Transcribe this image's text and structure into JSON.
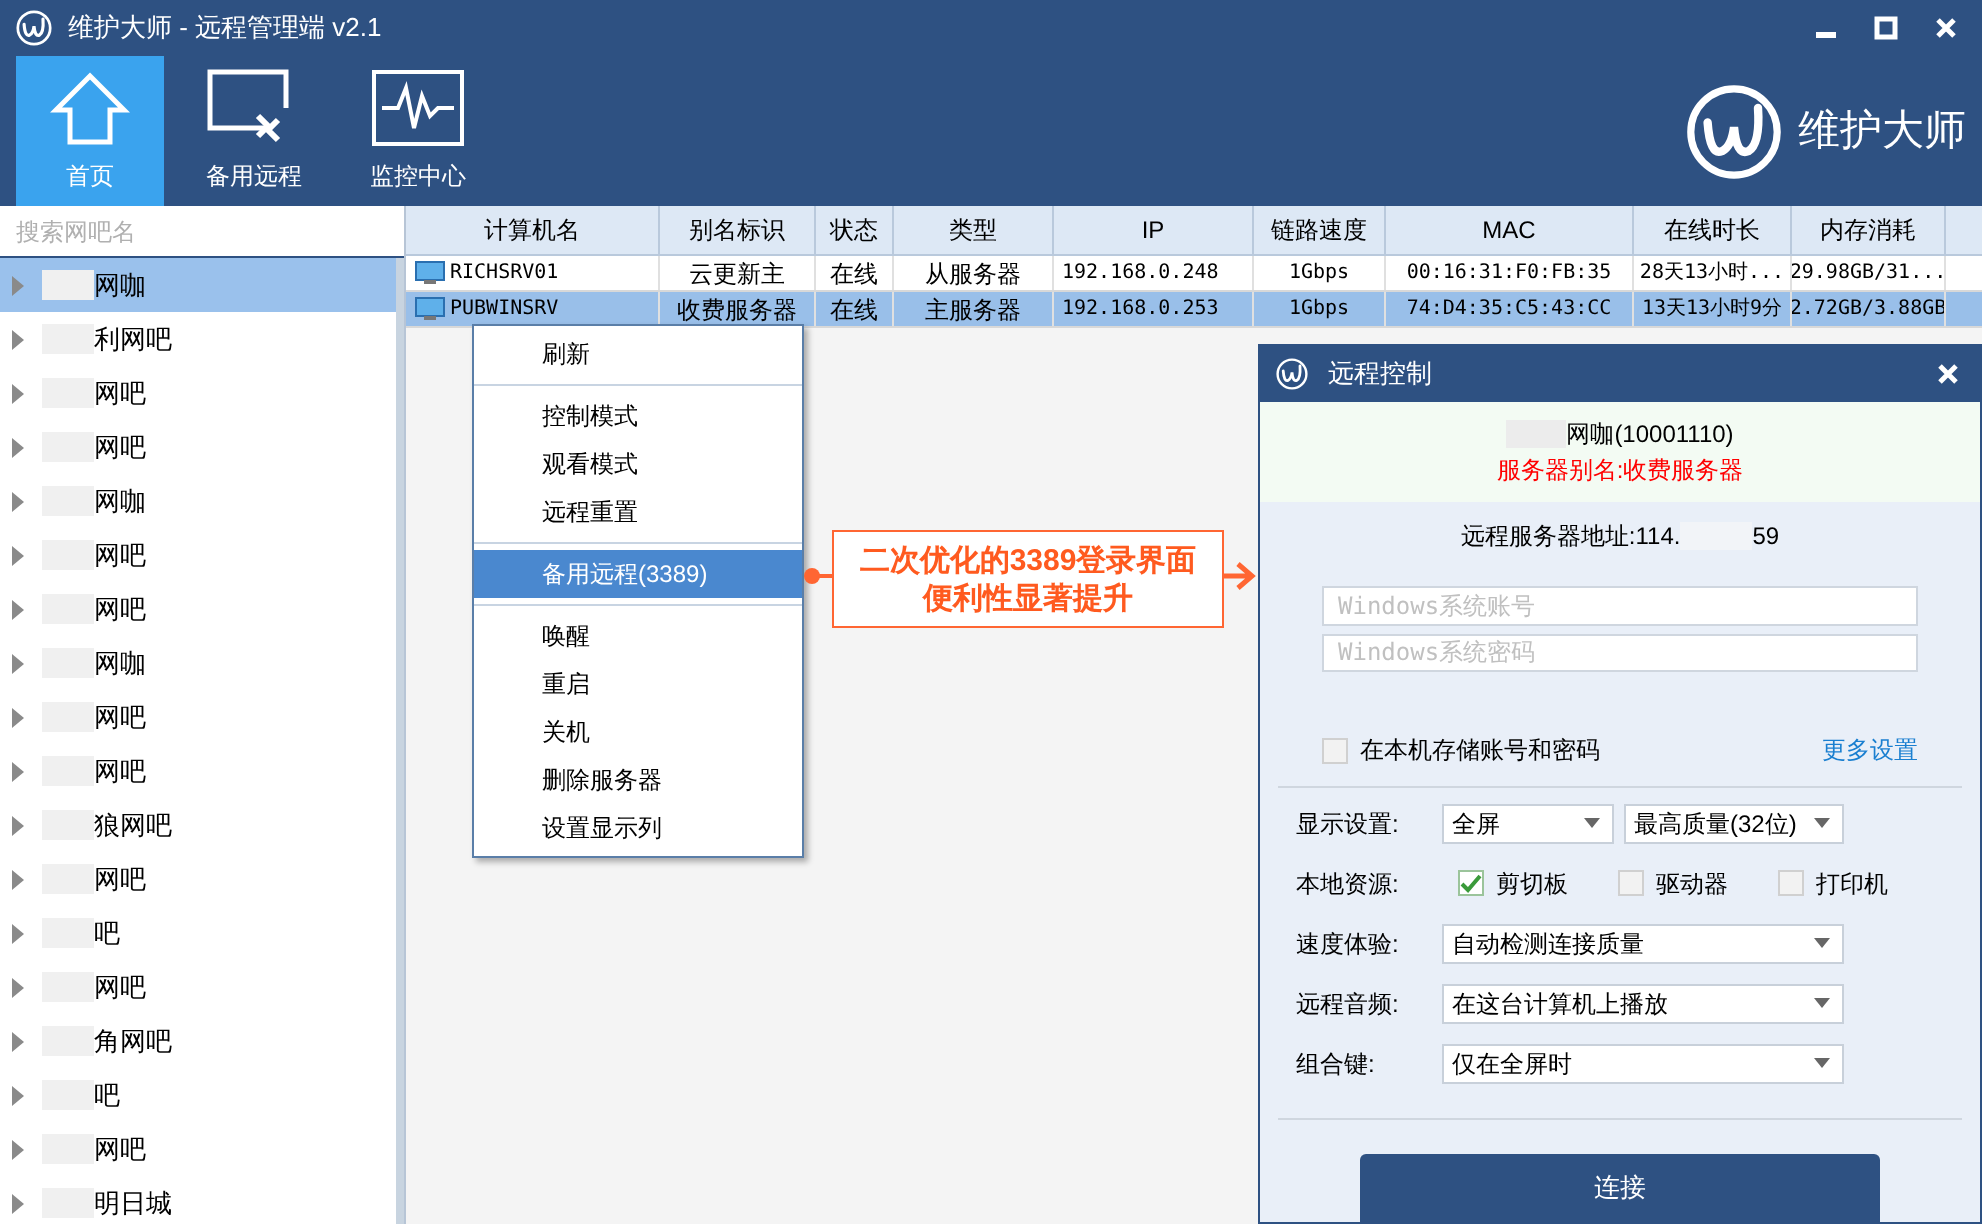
{
  "window": {
    "title": "维护大师 - 远程管理端 v2.1"
  },
  "toolbar": [
    {
      "label": "首页",
      "kind": "home",
      "selected": true
    },
    {
      "label": "备用远程",
      "kind": "remote",
      "selected": false
    },
    {
      "label": "监控中心",
      "kind": "monitor",
      "selected": false
    }
  ],
  "brand": {
    "name": "维护大师"
  },
  "sidebar": {
    "search": {
      "placeholder": "搜索网吧名"
    },
    "items": [
      {
        "label": "网咖",
        "selected": true
      },
      {
        "label": "利网吧",
        "selected": false
      },
      {
        "label": "网吧",
        "selected": false
      },
      {
        "label": "网吧",
        "selected": false
      },
      {
        "label": "网咖",
        "selected": false
      },
      {
        "label": "网吧",
        "selected": false
      },
      {
        "label": "网吧",
        "selected": false
      },
      {
        "label": "网咖",
        "selected": false
      },
      {
        "label": "网吧",
        "selected": false
      },
      {
        "label": "网吧",
        "selected": false
      },
      {
        "label": "狼网吧",
        "selected": false
      },
      {
        "label": "网吧",
        "selected": false
      },
      {
        "label": "吧",
        "selected": false
      },
      {
        "label": "网吧",
        "selected": false
      },
      {
        "label": "角网吧",
        "selected": false
      },
      {
        "label": "吧",
        "selected": false
      },
      {
        "label": "网吧",
        "selected": false
      },
      {
        "label": "明日城",
        "selected": false
      }
    ]
  },
  "table": {
    "columns": [
      "计算机名",
      "别名标识",
      "状态",
      "类型",
      "IP",
      "链路速度",
      "MAC",
      "在线时长",
      "内存消耗"
    ],
    "rows": [
      {
        "selected": false,
        "cells": [
          "RICHSRV01",
          "云更新主",
          "在线",
          "从服务器",
          "192.168.0.248",
          "1Gbps",
          "00:16:31:F0:FB:35",
          "28天13小时...",
          "29.98GB/31..."
        ]
      },
      {
        "selected": true,
        "cells": [
          "PUBWINSRV",
          "收费服务器",
          "在线",
          "主服务器",
          "192.168.0.253",
          "1Gbps",
          "74:D4:35:C5:43:CC",
          "13天13小时9分",
          "2.72GB/3.88GB"
        ]
      }
    ]
  },
  "context_menu": [
    {
      "kind": "item",
      "label": "刷新",
      "selected": false
    },
    {
      "kind": "separator"
    },
    {
      "kind": "item",
      "label": "控制模式",
      "selected": false
    },
    {
      "kind": "item",
      "label": "观看模式",
      "selected": false
    },
    {
      "kind": "item",
      "label": "远程重置",
      "selected": false
    },
    {
      "kind": "separator"
    },
    {
      "kind": "item",
      "label": "备用远程(3389)",
      "selected": true
    },
    {
      "kind": "separator"
    },
    {
      "kind": "item",
      "label": "唤醒",
      "selected": false
    },
    {
      "kind": "item",
      "label": "重启",
      "selected": false
    },
    {
      "kind": "item",
      "label": "关机",
      "selected": false
    },
    {
      "kind": "item",
      "label": "删除服务器",
      "selected": false
    },
    {
      "kind": "item",
      "label": "设置显示列",
      "selected": false
    }
  ],
  "callout": {
    "lines": [
      "二次优化的3389登录界面",
      "便利性显著提升"
    ]
  },
  "dialog": {
    "title": "远程控制",
    "site": "网咖(10001110)",
    "alias": "服务器别名:收费服务器",
    "address_label": "远程服务器地址:114.",
    "address_end": "59",
    "account": {
      "placeholder": "Windows系统账号"
    },
    "password": {
      "placeholder": "Windows系统密码"
    },
    "remember": {
      "label": "在本机存储账号和密码",
      "checked": false
    },
    "more_settings": "更多设置",
    "rows": [
      {
        "kind": "selects",
        "label": "显示设置:",
        "values": [
          "全屏",
          "最高质量(32位)"
        ]
      },
      {
        "kind": "checks",
        "label": "本地资源:",
        "options": [
          {
            "label": "剪切板",
            "checked": true
          },
          {
            "label": "驱动器",
            "checked": false
          },
          {
            "label": "打印机",
            "checked": false
          }
        ]
      },
      {
        "kind": "select",
        "label": "速度体验:",
        "value": "自动检测连接质量"
      },
      {
        "kind": "select",
        "label": "远程音频:",
        "value": "在这台计算机上播放"
      },
      {
        "kind": "select",
        "label": "组合键:",
        "value": "仅在全屏时"
      }
    ],
    "connect": "连接"
  }
}
